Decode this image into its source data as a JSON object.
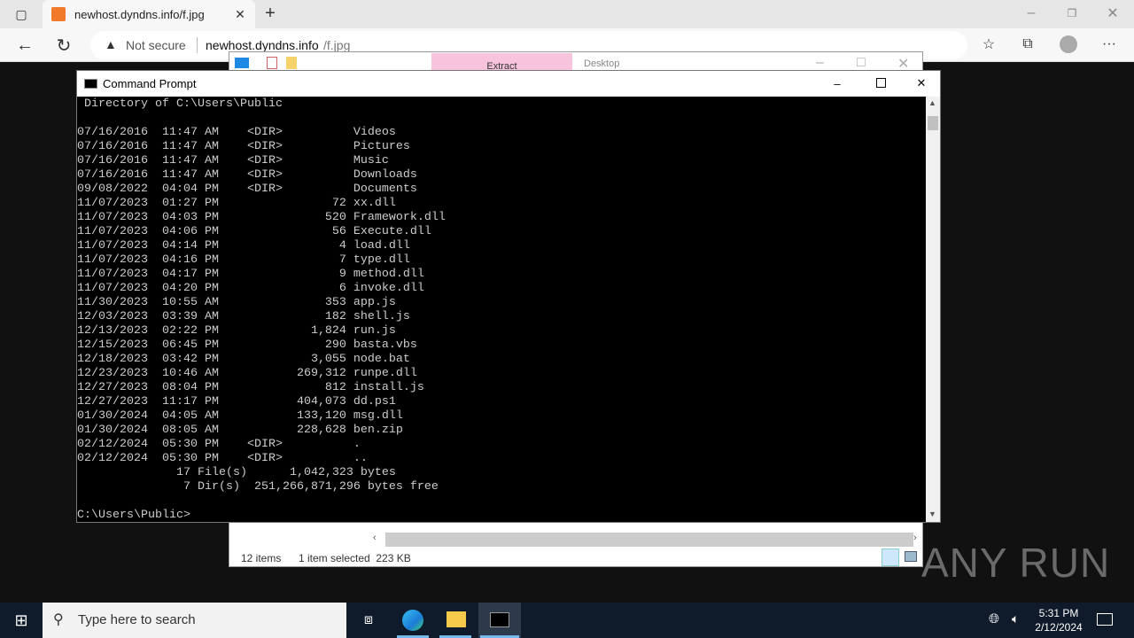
{
  "browser": {
    "tab_title": "newhost.dyndns.info/f.jpg",
    "security": "Not secure",
    "url_host": "newhost.dyndns.info",
    "url_path": "/f.jpg"
  },
  "explorer": {
    "ribbon_tab": "Extract",
    "path": "Desktop",
    "status_items": "12 items",
    "status_selected": "1 item selected  223 KB"
  },
  "cmd": {
    "title": "Command Prompt",
    "lines": [
      " Directory of C:\\Users\\Public",
      "",
      "07/16/2016  11:47 AM    <DIR>          Videos",
      "07/16/2016  11:47 AM    <DIR>          Pictures",
      "07/16/2016  11:47 AM    <DIR>          Music",
      "07/16/2016  11:47 AM    <DIR>          Downloads",
      "09/08/2022  04:04 PM    <DIR>          Documents",
      "11/07/2023  01:27 PM                72 xx.dll",
      "11/07/2023  04:03 PM               520 Framework.dll",
      "11/07/2023  04:06 PM                56 Execute.dll",
      "11/07/2023  04:14 PM                 4 load.dll",
      "11/07/2023  04:16 PM                 7 type.dll",
      "11/07/2023  04:17 PM                 9 method.dll",
      "11/07/2023  04:20 PM                 6 invoke.dll",
      "11/30/2023  10:55 AM               353 app.js",
      "12/03/2023  03:39 AM               182 shell.js",
      "12/13/2023  02:22 PM             1,824 run.js",
      "12/15/2023  06:45 PM               290 basta.vbs",
      "12/18/2023  03:42 PM             3,055 node.bat",
      "12/23/2023  10:46 AM           269,312 runpe.dll",
      "12/27/2023  08:04 PM               812 install.js",
      "12/27/2023  11:17 PM           404,073 dd.ps1",
      "01/30/2024  04:05 AM           133,120 msg.dll",
      "01/30/2024  08:05 AM           228,628 ben.zip",
      "02/12/2024  05:30 PM    <DIR>          .",
      "02/12/2024  05:30 PM    <DIR>          ..",
      "              17 File(s)      1,042,323 bytes",
      "               7 Dir(s)  251,266,871,296 bytes free",
      "",
      "C:\\Users\\Public>"
    ]
  },
  "taskbar": {
    "search_placeholder": "Type here to search",
    "time": "5:31 PM",
    "date": "2/12/2024"
  },
  "watermark": "ANY RUN"
}
